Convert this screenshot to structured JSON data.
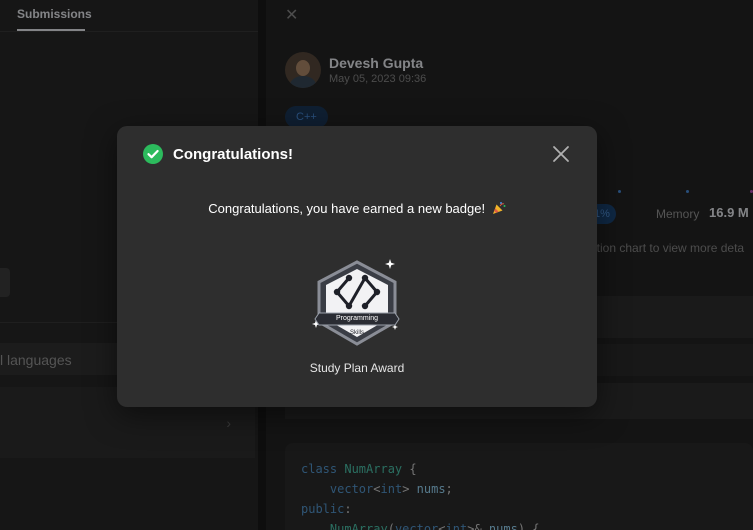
{
  "left_panel": {
    "tab_label": "Submissions",
    "language_filter": "l languages"
  },
  "right_panel": {
    "user_name": "Devesh Gupta",
    "post_date": "May 05, 2023 09:36",
    "language_tag": "C++",
    "runtime_percent": ".1%",
    "memory_label": "Memory",
    "memory_value": "16.9 M",
    "distribution_hint": "ution chart to view more deta",
    "code_lines": [
      "class NumArray {",
      "    vector<int> nums;",
      "public:",
      "    NumArray(vector<int>& nums) {"
    ]
  },
  "modal": {
    "title": "Congratulations!",
    "message": "Congratulations, you have earned a new badge!",
    "badge_text_line1": "Programming",
    "badge_text_line2": "Skills",
    "badge_caption": "Study Plan Award",
    "success_color": "#2cbb5d"
  }
}
